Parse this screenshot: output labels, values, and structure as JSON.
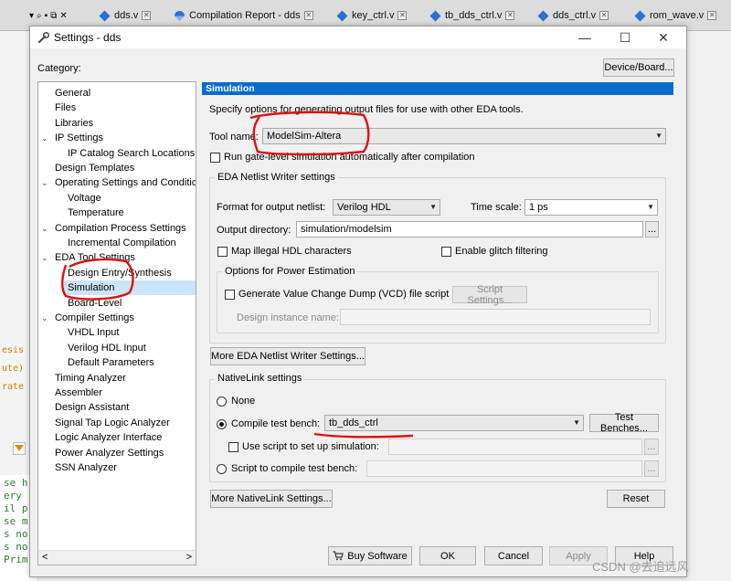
{
  "ide": {
    "tabs": [
      {
        "label": "dds.v"
      },
      {
        "label": "Compilation Report - dds"
      },
      {
        "label": "key_ctrl.v"
      },
      {
        "label": "tb_dds_ctrl.v"
      },
      {
        "label": "dds_ctrl.v"
      },
      {
        "label": "rom_wave.v"
      }
    ],
    "left_fragments": [
      "esis",
      "ute)",
      "rate"
    ],
    "code_fragments": "se h\nery\nil p\nse m\ns no\ns no\nPrim"
  },
  "dialog": {
    "title": "Settings - dds",
    "minimize": "—",
    "maximize": "☐",
    "close": "✕",
    "category_label": "Category:",
    "device_board_button": "Device/Board...",
    "tree": [
      {
        "label": "General",
        "level": 0,
        "arrow": ""
      },
      {
        "label": "Files",
        "level": 0,
        "arrow": ""
      },
      {
        "label": "Libraries",
        "level": 0,
        "arrow": ""
      },
      {
        "label": "IP Settings",
        "level": 0,
        "arrow": "⌄"
      },
      {
        "label": "IP Catalog Search Locations",
        "level": 1,
        "arrow": ""
      },
      {
        "label": "Design Templates",
        "level": 0,
        "arrow": ""
      },
      {
        "label": "Operating Settings and Conditic",
        "level": 0,
        "arrow": "⌄"
      },
      {
        "label": "Voltage",
        "level": 1,
        "arrow": ""
      },
      {
        "label": "Temperature",
        "level": 1,
        "arrow": ""
      },
      {
        "label": "Compilation Process Settings",
        "level": 0,
        "arrow": "⌄"
      },
      {
        "label": "Incremental Compilation",
        "level": 1,
        "arrow": ""
      },
      {
        "label": "EDA Tool Settings",
        "level": 0,
        "arrow": "⌄"
      },
      {
        "label": "Design Entry/Synthesis",
        "level": 1,
        "arrow": ""
      },
      {
        "label": "Simulation",
        "level": 1,
        "arrow": "",
        "selected": true
      },
      {
        "label": "Board-Level",
        "level": 1,
        "arrow": ""
      },
      {
        "label": "Compiler Settings",
        "level": 0,
        "arrow": "⌄"
      },
      {
        "label": "VHDL Input",
        "level": 1,
        "arrow": ""
      },
      {
        "label": "Verilog HDL Input",
        "level": 1,
        "arrow": ""
      },
      {
        "label": "Default Parameters",
        "level": 1,
        "arrow": ""
      },
      {
        "label": "Timing Analyzer",
        "level": 0,
        "arrow": ""
      },
      {
        "label": "Assembler",
        "level": 0,
        "arrow": ""
      },
      {
        "label": "Design Assistant",
        "level": 0,
        "arrow": ""
      },
      {
        "label": "Signal Tap Logic Analyzer",
        "level": 0,
        "arrow": ""
      },
      {
        "label": "Logic Analyzer Interface",
        "level": 0,
        "arrow": ""
      },
      {
        "label": "Power Analyzer Settings",
        "level": 0,
        "arrow": ""
      },
      {
        "label": "SSN Analyzer",
        "level": 0,
        "arrow": ""
      }
    ],
    "tree_scroll_left": "<",
    "tree_scroll_right": ">",
    "panel": {
      "header": "Simulation",
      "description": "Specify options for generating output files for use with other EDA tools.",
      "tool_name_label": "Tool name:",
      "tool_name_value": "ModelSim-Altera",
      "run_gate_level_label": "Run gate-level simulation automatically after compilation",
      "eda_netlist_group": "EDA Netlist Writer settings",
      "format_label": "Format for output netlist:",
      "format_value": "Verilog HDL",
      "time_scale_label": "Time scale:",
      "time_scale_value": "1 ps",
      "output_dir_label": "Output directory:",
      "output_dir_value": "simulation/modelsim",
      "browse_label": "...",
      "map_illegal_label": "Map illegal HDL characters",
      "enable_glitch_label": "Enable glitch filtering",
      "power_group": "Options for Power Estimation",
      "vcd_label": "Generate Value Change Dump (VCD) file script",
      "script_settings_button": "Script Settings...",
      "design_instance_label": "Design instance name:",
      "more_eda_button": "More EDA Netlist Writer Settings...",
      "nativelink_group": "NativeLink settings",
      "none_label": "None",
      "compile_tb_label": "Compile test bench:",
      "compile_tb_value": "tb_dds_ctrl",
      "test_benches_button": "Test Benches...",
      "use_script_label": "Use script to set up simulation:",
      "script_compile_label": "Script to compile test bench:",
      "more_nativelink_button": "More NativeLink Settings...",
      "reset_button": "Reset"
    },
    "footer": {
      "buy_software": "Buy Software",
      "ok": "OK",
      "cancel": "Cancel",
      "apply": "Apply",
      "help": "Help"
    }
  },
  "watermark": "CSDN @去追远风",
  "colors": {
    "accent": "#0a6bcc",
    "selection": "#cce4f7",
    "annotation": "#e01010"
  }
}
